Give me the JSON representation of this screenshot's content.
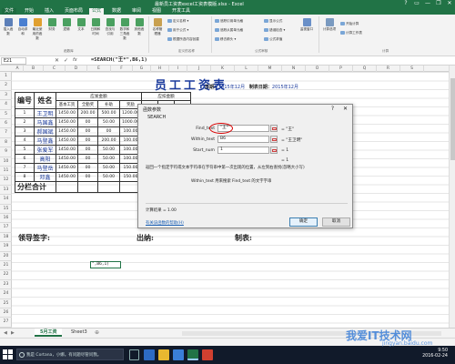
{
  "window": {
    "title": "最新员工资表excel工资表模版.xlsx - Excel",
    "controls": [
      "?",
      "▭",
      "—",
      "❐",
      "✕"
    ]
  },
  "tabs": [
    "文件",
    "开始",
    "插入",
    "页面布局",
    "公式",
    "数据",
    "审阅",
    "视图",
    "开发工具"
  ],
  "active_tab_index": 4,
  "ribbon": {
    "big_buttons": [
      "插入函数",
      "自动求和",
      "最近使用的函数",
      "财务",
      "逻辑",
      "文本",
      "日期和时间",
      "查找与引用",
      "数学和三角函数",
      "其他函数",
      "名称管理器"
    ],
    "name_group": [
      "定义名称 ▾",
      "用于公式 ▾",
      "根据所选内容创建"
    ],
    "audit_group": [
      "追踪引用单元格",
      "追踪从属单元格",
      "移去箭头 ▾"
    ],
    "audit_group2": [
      "显示公式",
      "错误检查 ▾",
      "公式求值"
    ],
    "watch": "监视窗口",
    "calc": [
      "计算选项",
      "开始计算",
      "计算工作表"
    ],
    "group_labels": [
      "函数库",
      "定义的名称",
      "公式审核",
      "计算"
    ]
  },
  "formula_bar": {
    "name_box": "E21",
    "cancel": "✕",
    "enter": "✓",
    "fx": "fx",
    "formula": "=SEARCH(\"王*\",B6,1)"
  },
  "columns": [
    "A",
    "B",
    "C",
    "D",
    "E",
    "F",
    "G",
    "H",
    "I",
    "J",
    "K",
    "L",
    "M",
    "N",
    "O",
    "P",
    "Q",
    "R",
    "S"
  ],
  "rows": [
    "1",
    "2",
    "3",
    "4",
    "5",
    "6",
    "7",
    "8",
    "9",
    "10",
    "11",
    "12",
    "13",
    "14",
    "15",
    "16",
    "17",
    "18",
    "19",
    "20",
    "21",
    "22",
    "23",
    "24",
    "25",
    "26",
    "27"
  ],
  "sheet": {
    "title": "员工工资表",
    "date_prefix": "日期：",
    "date_value": "2015年12月",
    "date_mid": "制表日期：",
    "date_value2": "2015年12月",
    "header_no": "编号",
    "header_name": "姓名",
    "header_group1": "应发金额",
    "header_group2": "应扣金额",
    "sub_headers": [
      "基本工资",
      "全勤奖",
      "补助",
      "奖励",
      "",
      "",
      ""
    ],
    "employees": [
      {
        "no": "1",
        "name": "王卫明",
        "vals": [
          "1450.00",
          "200.00",
          "500.00",
          "1200.00",
          "50.00"
        ]
      },
      {
        "no": "2",
        "name": "马国鑫",
        "vals": [
          "1450.00",
          "00",
          "50.00",
          "1000.00",
          ""
        ]
      },
      {
        "no": "3",
        "name": "郝国斌",
        "vals": [
          "1450.00",
          "00",
          "00",
          "100.00",
          ""
        ]
      },
      {
        "no": "4",
        "name": "马登鑫",
        "vals": [
          "1450.00",
          "00",
          "200.00",
          "100.00",
          ""
        ]
      },
      {
        "no": "5",
        "name": "张爱军",
        "vals": [
          "1450.00",
          "00",
          "50.00",
          "100.00",
          ""
        ]
      },
      {
        "no": "6",
        "name": "高阳",
        "vals": [
          "1450.00",
          "00",
          "50.00",
          "100.00",
          ""
        ]
      },
      {
        "no": "7",
        "name": "马登岳",
        "vals": [
          "1450.00",
          "00",
          "50.00",
          "150.00",
          ""
        ]
      },
      {
        "no": "8",
        "name": "邓鑫",
        "vals": [
          "1450.00",
          "00",
          "50.00",
          "150.00",
          ""
        ]
      }
    ],
    "subtotal": "分栏合计",
    "sig_leader": "领导签字:",
    "sig_cashier": "出纳:",
    "sig_maker": "制表:",
    "cell_edit": "\",B6,1)"
  },
  "dialog": {
    "title": "函数参数",
    "help": "?",
    "close": "✕",
    "function_name": "SEARCH",
    "args": [
      {
        "label": "Find_text",
        "value": "\"王*\"",
        "result": "= \"王\""
      },
      {
        "label": "Within_text",
        "value": "B6",
        "result": "= \"王卫明\""
      },
      {
        "label": "Start_num",
        "value": "1",
        "result": "= 1"
      }
    ],
    "eq_result": "= 1",
    "description": "返回一个指定字符或文本字符串在字符串中第一次出现的位置，从左到右查找(忽略大小写)",
    "arg_description": "Within_text  用来搜索 Find_text 的文字字串",
    "calc_result": "计算结果 = 1.00",
    "help_link": "有关该函数的帮助(H)",
    "ok": "确定",
    "cancel": "取消"
  },
  "sheet_tabs": [
    "5月工资",
    "Sheet3"
  ],
  "sheet_add": "⊕",
  "taskbar": {
    "search_placeholder": "我是 Cortana，小娜。有问题尽管问我。",
    "time": "9:50",
    "date": "2016-02-24"
  },
  "watermark": {
    "text": "我爱IT技术网",
    "url": "jingyan.baidu.com"
  },
  "colors": {
    "excel_green": "#217346",
    "title_blue": "#1a3a9c",
    "highlight_red": "#d80000"
  }
}
